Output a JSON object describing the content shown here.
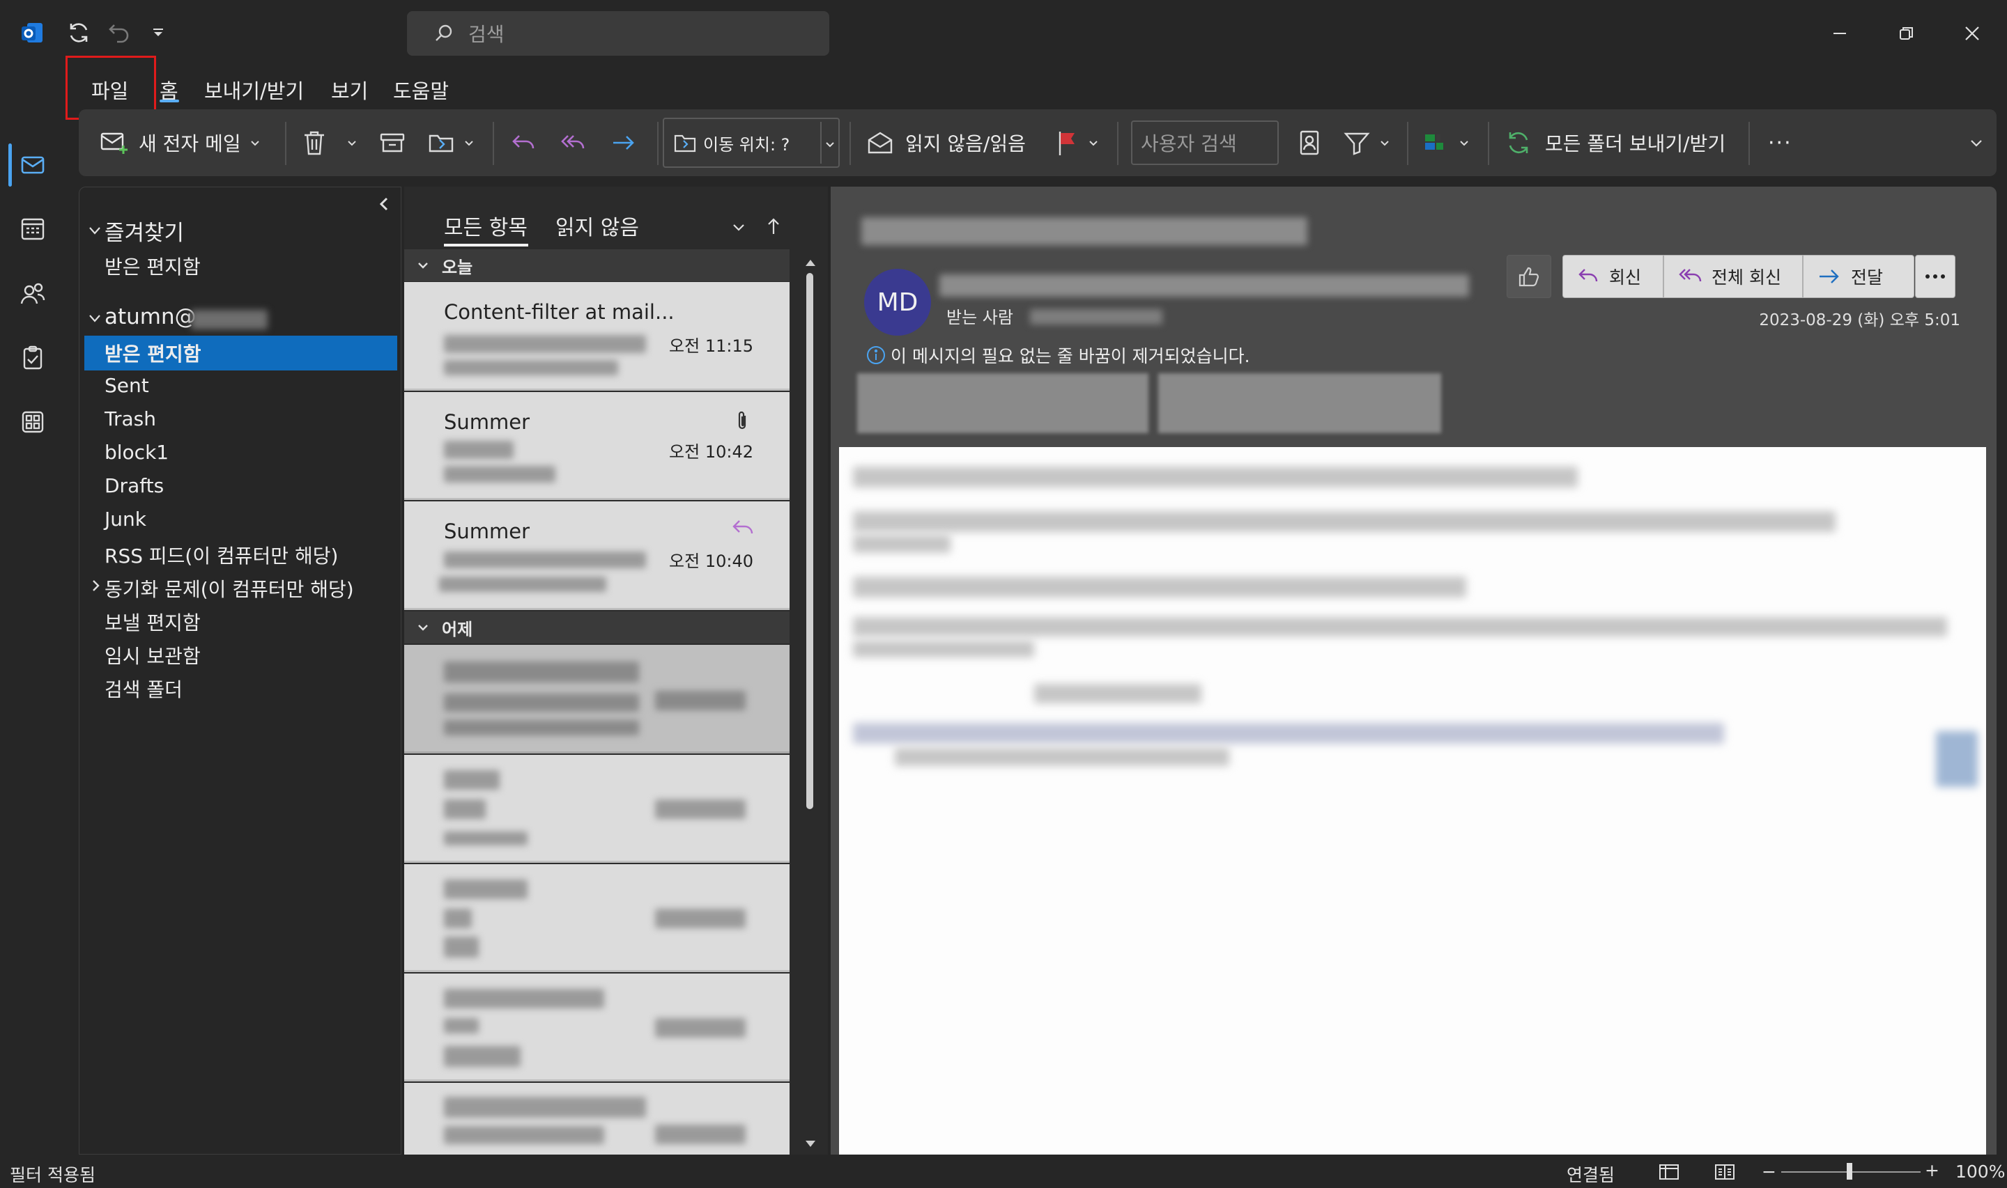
{
  "titlebar": {
    "search_placeholder": "검색"
  },
  "menu": {
    "file": "파일",
    "home": "홈",
    "send_receive": "보내기/받기",
    "view": "보기",
    "help": "도움말"
  },
  "ribbon": {
    "new_mail": "새 전자 메일",
    "move_to": "이동 위치: ?",
    "read_unread": "읽지 않음/읽음",
    "people_search_placeholder": "사용자 검색",
    "send_receive_all": "모든 폴더 보내기/받기",
    "more": "···"
  },
  "folders": {
    "favorites_header": "즐겨찾기",
    "favorites_inbox": "받은 편지함",
    "account": "atumn@",
    "items": [
      {
        "label": "받은 편지함",
        "selected": true
      },
      {
        "label": "Sent"
      },
      {
        "label": "Trash"
      },
      {
        "label": "block1"
      },
      {
        "label": "Drafts"
      },
      {
        "label": "Junk"
      },
      {
        "label": "RSS 피드(이 컴퓨터만 해당)"
      },
      {
        "label": "동기화 문제(이 컴퓨터만 해당)",
        "expandable": true
      },
      {
        "label": "보낼 편지함"
      },
      {
        "label": "임시 보관함"
      },
      {
        "label": "검색 폴더"
      }
    ]
  },
  "message_list": {
    "tab_all": "모든 항목",
    "tab_unread": "읽지 않음",
    "group_today": "오늘",
    "group_yesterday": "어제",
    "messages": [
      {
        "from": "Content-filter at mail...",
        "time": "오전 11:15"
      },
      {
        "from": "Summer",
        "time": "오전 10:42",
        "icon": "paperclip-icon"
      },
      {
        "from": "Summer",
        "time": "오전 10:40",
        "icon": "reply-icon"
      }
    ]
  },
  "reading": {
    "avatar_initials": "MD",
    "to_label": "받는 사람",
    "date": "2023-08-29 (화) 오후 5:01",
    "notice": "이 메시지의 필요 없는 줄 바꿈이 제거되었습니다.",
    "reply": "회신",
    "reply_all": "전체 회신",
    "forward": "전달"
  },
  "status": {
    "filter": "필터 적용됨",
    "connection": "연결됨",
    "zoom": "100%"
  },
  "colors": {
    "accent": "#0f6cbd",
    "file_highlight": "#e01b1b",
    "flag": "#d13438",
    "reply_all_purple": "#b36fd0"
  }
}
